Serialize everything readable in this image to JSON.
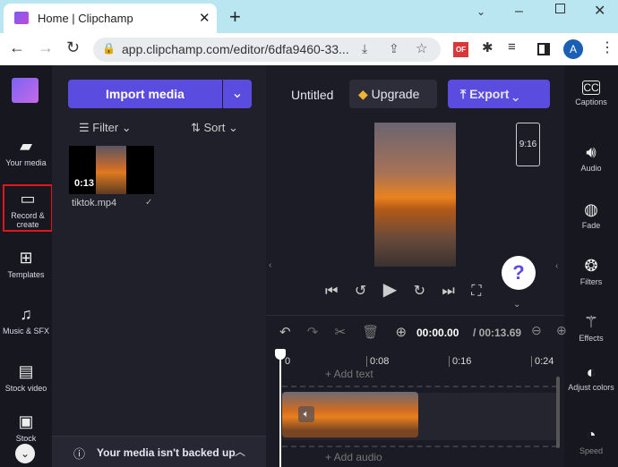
{
  "browser": {
    "tab_title": "Home | Clipchamp",
    "url": "app.clipchamp.com/editor/6dfa9460-33...",
    "profile_initial": "A",
    "ext_badge": "OF"
  },
  "rail": [
    {
      "label": "Your media",
      "icon": "folder-icon"
    },
    {
      "label": "Record & create",
      "icon": "camera-icon"
    },
    {
      "label": "Templates",
      "icon": "templates-icon"
    },
    {
      "label": "Music & SFX",
      "icon": "music-icon"
    },
    {
      "label": "Stock video",
      "icon": "film-icon"
    },
    {
      "label": "Stock",
      "icon": "image-icon"
    }
  ],
  "media": {
    "import_label": "Import media",
    "filter_label": "Filter",
    "sort_label": "Sort",
    "file_name": "tiktok.mp4",
    "duration": "0:13",
    "backup_text": "Your media isn't backed up"
  },
  "header": {
    "title": "Untitled",
    "upgrade_label": "Upgrade",
    "export_label": "Export",
    "aspect": "9:16"
  },
  "right": [
    {
      "label": "Captions",
      "icon": "cc-icon"
    },
    {
      "label": "Audio",
      "icon": "speaker-icon"
    },
    {
      "label": "Fade",
      "icon": "fade-icon"
    },
    {
      "label": "Filters",
      "icon": "filters-icon"
    },
    {
      "label": "Effects",
      "icon": "wand-icon"
    },
    {
      "label": "Adjust colors",
      "icon": "contrast-icon"
    },
    {
      "label": "Speed",
      "icon": "speedometer-icon"
    }
  ],
  "timeline": {
    "current": "00:00.00",
    "total": "/ 00:13.69",
    "ticks": [
      "0",
      "0:08",
      "0:16",
      "0:24"
    ],
    "add_text": "+ Add text",
    "add_audio": "+ Add audio"
  },
  "colors": {
    "accent": "#5b4ce0",
    "highlight": "#e0161b"
  }
}
